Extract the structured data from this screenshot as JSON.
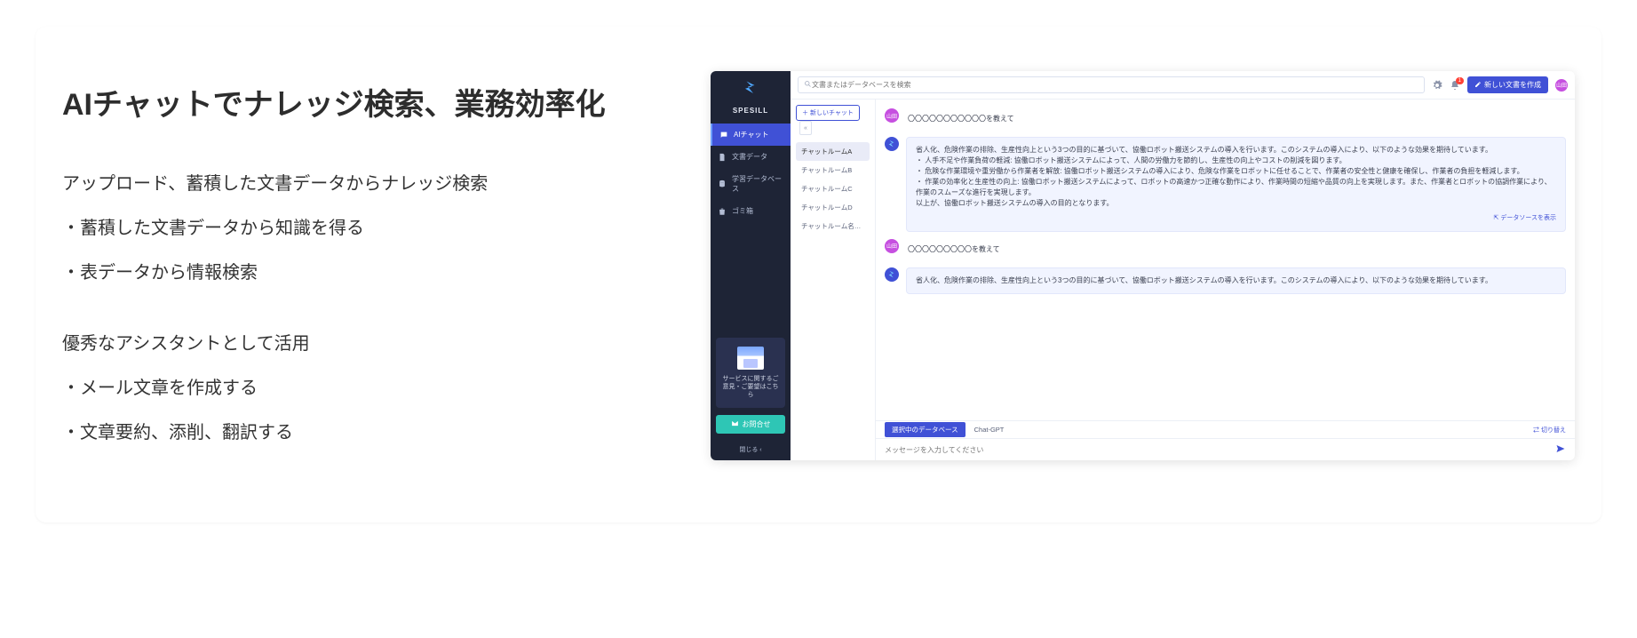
{
  "left": {
    "heading": "AIチャットでナレッジ検索、業務効率化",
    "line1": "アップロード、蓄積した文書データからナレッジ検索",
    "bullet1": "・蓄積した文書データから知識を得る",
    "bullet2": "・表データから情報検索",
    "line2": "優秀なアシスタントとして活用",
    "bullet3": "・メール文章を作成する",
    "bullet4": "・文章要約、添削、翻訳する"
  },
  "app": {
    "brand": "SPESILL",
    "sidebar": {
      "items": [
        {
          "label": "AIチャット"
        },
        {
          "label": "文書データ"
        },
        {
          "label": "学習データベース"
        },
        {
          "label": "ゴミ箱"
        }
      ],
      "card_text": "サービスに関するご意見・ご要望はこちら",
      "contact": "お問合せ",
      "close": "閉じる"
    },
    "search_placeholder": "文書またはデータベースを検索",
    "new_doc": "新しい文書を作成",
    "avatar": "山田",
    "notif_count": "1",
    "rooms": {
      "new_chat": "＋ 新しいチャット",
      "items": [
        "チャットルームA",
        "チャットルームB",
        "チャットルームC",
        "チャットルームD",
        "チャットルーム名が長…"
      ]
    },
    "messages": {
      "u1": "〇〇〇〇〇〇〇〇〇〇〇を教えて",
      "a1_p1": "省人化、危険作業の排除、生産性向上という3つの目的に基づいて、協働ロボット搬送システムの導入を行います。このシステムの導入により、以下のような効果を期待しています。",
      "a1_b1": "・ 人手不足や作業負荷の軽減: 協働ロボット搬送システムによって、人間の労働力を節約し、生産性の向上やコストの削減を図ります。",
      "a1_b2": "・ 危険な作業環境や重労働から作業者を解放: 協働ロボット搬送システムの導入により、危険な作業をロボットに任せることで、作業者の安全性と健康を確保し、作業者の負担を軽減します。",
      "a1_b3": "・ 作業の効率化と生産性の向上: 協働ロボット搬送システムによって、ロボットの高速かつ正確な動作により、作業時間の短縮や品質の向上を実現します。また、作業者とロボットの協調作業により、作業のスムーズな進行を実現します。",
      "a1_p2": "以上が、協働ロボット搬送システムの導入の目的となります。",
      "ds_link": "データソースを表示",
      "u2": "〇〇〇〇〇〇〇〇〇を教えて",
      "a2": "省人化、危険作業の排除、生産性向上という3つの目的に基づいて、協働ロボット搬送システムの導入を行います。このシステムの導入により、以下のような効果を期待しています。"
    },
    "context": {
      "pill": "選択中のデータベース",
      "model": "Chat-GPT",
      "switch": "切り替え"
    },
    "input_placeholder": "メッセージを入力してください"
  }
}
